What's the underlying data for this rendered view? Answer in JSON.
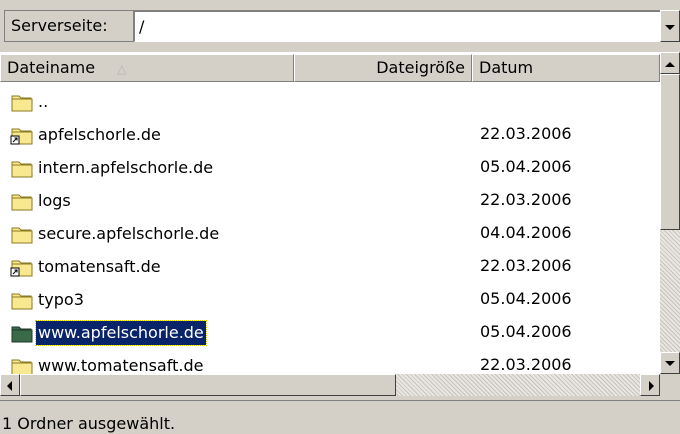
{
  "path_bar": {
    "label": "Serverseite:",
    "value": "/"
  },
  "columns": {
    "name": "Dateiname",
    "size": "Dateigröße",
    "date": "Datum"
  },
  "rows": [
    {
      "name": "..",
      "size": "",
      "date": "",
      "icon": "folder-icon"
    },
    {
      "name": "apfelschorle.de",
      "size": "",
      "date": "22.03.2006",
      "icon": "folder-link-icon"
    },
    {
      "name": "intern.apfelschorle.de",
      "size": "",
      "date": "05.04.2006",
      "icon": "folder-icon"
    },
    {
      "name": "logs",
      "size": "",
      "date": "22.03.2006",
      "icon": "folder-icon"
    },
    {
      "name": "secure.apfelschorle.de",
      "size": "",
      "date": "04.04.2006",
      "icon": "folder-icon"
    },
    {
      "name": "tomatensaft.de",
      "size": "",
      "date": "22.03.2006",
      "icon": "folder-link-icon"
    },
    {
      "name": "typo3",
      "size": "",
      "date": "05.04.2006",
      "icon": "folder-icon"
    },
    {
      "name": "www.apfelschorle.de",
      "size": "",
      "date": "05.04.2006",
      "icon": "folder-icon",
      "selected": true
    },
    {
      "name": "www.tomatensaft.de",
      "size": "",
      "date": "22.03.2006",
      "icon": "folder-icon"
    }
  ],
  "status": {
    "text": "1 Ordner ausgewählt."
  },
  "colors": {
    "selection": "#0a246a",
    "folder_fill": "#f8e890",
    "folder_outline": "#8a7a20",
    "selected_folder": "#3a6a4a"
  }
}
